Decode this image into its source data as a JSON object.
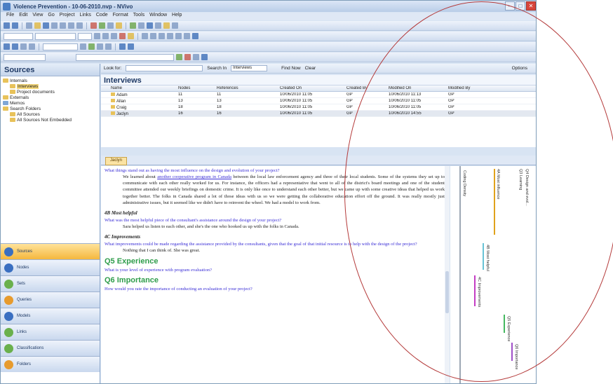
{
  "window": {
    "title": "Violence Prevention - 10-06-2010.nvp - NVivo"
  },
  "menu": [
    "File",
    "Edit",
    "View",
    "Go",
    "Project",
    "Links",
    "Code",
    "Format",
    "Tools",
    "Window",
    "Help"
  ],
  "sources_pane": {
    "title": "Sources",
    "tree": [
      {
        "label": "Internals",
        "level": 0,
        "selected": false
      },
      {
        "label": "Interviews",
        "level": 1,
        "selected": true
      },
      {
        "label": "Project documents",
        "level": 1,
        "selected": false
      },
      {
        "label": "Externals",
        "level": 0,
        "selected": false
      },
      {
        "label": "Memos",
        "level": 0,
        "selected": false
      },
      {
        "label": "Search Folders",
        "level": 0,
        "selected": false
      },
      {
        "label": "All Sources",
        "level": 1,
        "selected": false
      },
      {
        "label": "All Sources Not Embedded",
        "level": 1,
        "selected": false
      }
    ]
  },
  "nav_buttons": [
    {
      "label": "Sources",
      "active": true
    },
    {
      "label": "Nodes",
      "active": false
    },
    {
      "label": "Sets",
      "active": false
    },
    {
      "label": "Queries",
      "active": false
    },
    {
      "label": "Models",
      "active": false
    },
    {
      "label": "Links",
      "active": false
    },
    {
      "label": "Classifications",
      "active": false
    },
    {
      "label": "Folders",
      "active": false
    }
  ],
  "find_bar": {
    "look_for_label": "Look for:",
    "search_in_label": "Search In",
    "search_in_value": "Interviews",
    "find_now": "Find Now",
    "clear": "Clear",
    "options": "Options"
  },
  "list": {
    "title": "Interviews",
    "columns": [
      "Name",
      "Nodes",
      "References",
      "Created On",
      "Created By",
      "Modified On",
      "Modified By"
    ],
    "rows": [
      [
        "Adam",
        "11",
        "11",
        "10/06/2010 11:05",
        "GP",
        "10/06/2010 11:13",
        "GP"
      ],
      [
        "Allan",
        "13",
        "13",
        "10/06/2010 11:05",
        "GP",
        "10/06/2010 11:05",
        "GP"
      ],
      [
        "Craig",
        "18",
        "18",
        "10/06/2010 11:05",
        "GP",
        "10/06/2010 11:05",
        "GP"
      ],
      [
        "Jaclyn",
        "16",
        "16",
        "10/06/2010 11:05",
        "GP",
        "10/06/2010 14:55",
        "GP"
      ]
    ],
    "selected_row": 3
  },
  "detail_tab": "Jaclyn",
  "document": {
    "q1": "What things stand out as having the most influence on the design and evolution of your project?",
    "a1_parts": [
      "We learned about ",
      "another cooperative program in Canada",
      " between the local law enforcement agency and three of their local students. Some of the systems they set up to communicate with each other really worked for us. For instance, the officers had a representative that went to all of the district's board meetings and one of the student committee attended our weekly briefings on domestic crime. It is only like once to understand each other better, but we came up with some creative ideas that helped us work together better. The folks in Canada shared a lot of those ideas with us so we were getting the collaborative education effort off the ground. It was really mostly just administrative issues, but it seemed like we didn't have to reinvent the wheel. We had a model to work from."
    ],
    "h_4b": "4B Most helpful",
    "q2": "What was the most helpful piece of the consultant's assistance around the design of your project?",
    "a2": "Sara helped us listen to each other, and she's the one who hooked us up with the folks in Canada.",
    "h_4c": "4C Improvements",
    "q3": "What improvements could be made regarding the assistance provided by the consultants, given that the goal of that initial resource is to help with the design of the project?",
    "a3": "Nothing that I can think of. She was great.",
    "h_q5": "Q5 Experience",
    "q5": "What is your level of experience with program evaluation?",
    "h_q6": "Q6 Importance",
    "q6": "How would you rate the importance of conducting an evaluation of your project?"
  },
  "coding_stripes": {
    "density_label": "Coding Density",
    "labels": [
      "Q4 Design and evol...",
      "Q3 Learning",
      "4A Most influence",
      "4B Most helpful",
      "4C Improvements",
      "Q5 Experience",
      "Q6 Importance"
    ],
    "colors": [
      "#e0a21c",
      "#67c3d6",
      "#c43cc4",
      "#44b860",
      "#a050c8"
    ]
  },
  "annotation_color": "#b43a3a"
}
